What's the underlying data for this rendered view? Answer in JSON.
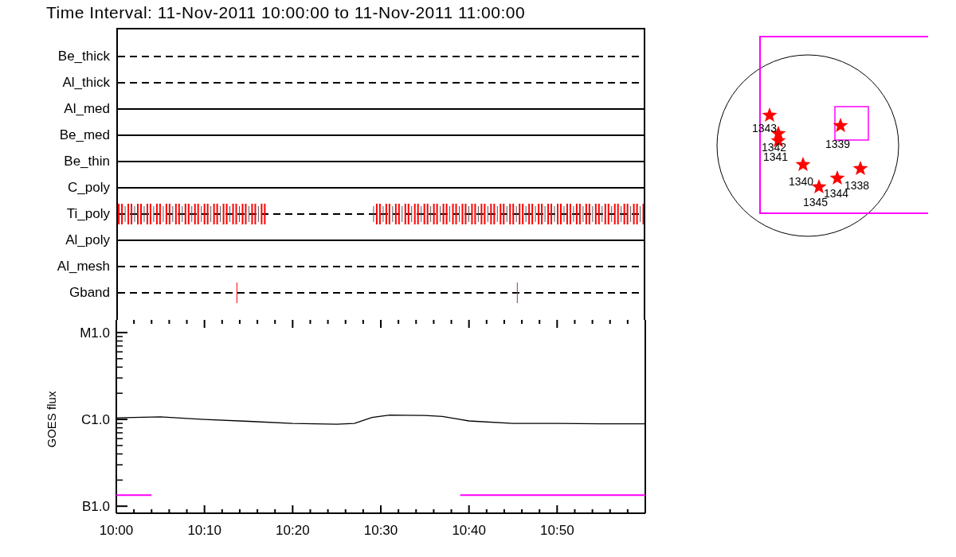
{
  "title": "Time Interval: 11-Nov-2011 10:00:00 to 11-Nov-2011 11:00:00",
  "filters": [
    {
      "label": "Be_thick",
      "kind": "dashed",
      "events": false
    },
    {
      "label": "Al_thick",
      "kind": "dashed",
      "events": false
    },
    {
      "label": "Al_med",
      "kind": "solid",
      "events": false
    },
    {
      "label": "Be_med",
      "kind": "solid",
      "events": false
    },
    {
      "label": "Be_thin",
      "kind": "solid",
      "events": false
    },
    {
      "label": "C_poly",
      "kind": "solid",
      "events": false
    },
    {
      "label": "Ti_poly",
      "kind": "dashed",
      "events": true
    },
    {
      "label": "Al_poly",
      "kind": "solid",
      "events": false
    },
    {
      "label": "Al_mesh",
      "kind": "dashed",
      "events": false
    },
    {
      "label": "Gband",
      "kind": "dashed",
      "events": true
    }
  ],
  "goes": {
    "ylabel": "GOES flux",
    "y_labels": [
      "M1.0",
      "C1.0",
      "B1.0"
    ],
    "x_labels": [
      "10:00",
      "10:10",
      "10:20",
      "10:30",
      "10:40",
      "10:50"
    ]
  },
  "map": {
    "regions": [
      {
        "label": "1343"
      },
      {
        "label": "1342"
      },
      {
        "label": "1341"
      },
      {
        "label": "1339"
      },
      {
        "label": "1340"
      },
      {
        "label": "1338"
      },
      {
        "label": "1344"
      },
      {
        "label": "1345"
      }
    ]
  }
}
